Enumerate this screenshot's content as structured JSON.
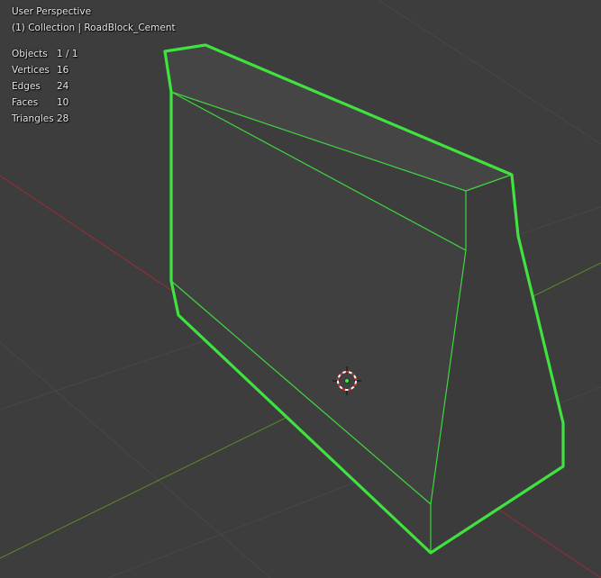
{
  "viewport": {
    "mode_label": "User Perspective",
    "collection_label": "(1) Collection | RoadBlock_Cement"
  },
  "stats": [
    {
      "label": "Objects",
      "value": "1 / 1"
    },
    {
      "label": "Vertices",
      "value": "16"
    },
    {
      "label": "Edges",
      "value": "24"
    },
    {
      "label": "Faces",
      "value": "10"
    },
    {
      "label": "Triangles",
      "value": "28"
    }
  ],
  "colors": {
    "background": "#3d3d3d",
    "grid_line": "#464646",
    "x_axis": "#9a2e36",
    "y_axis": "#5b8a2c",
    "selection_outline": "#3fe23f",
    "inner_edge": "#3fd63f",
    "object_face": "#434343",
    "object_face_dark": "#3a3a3a"
  }
}
